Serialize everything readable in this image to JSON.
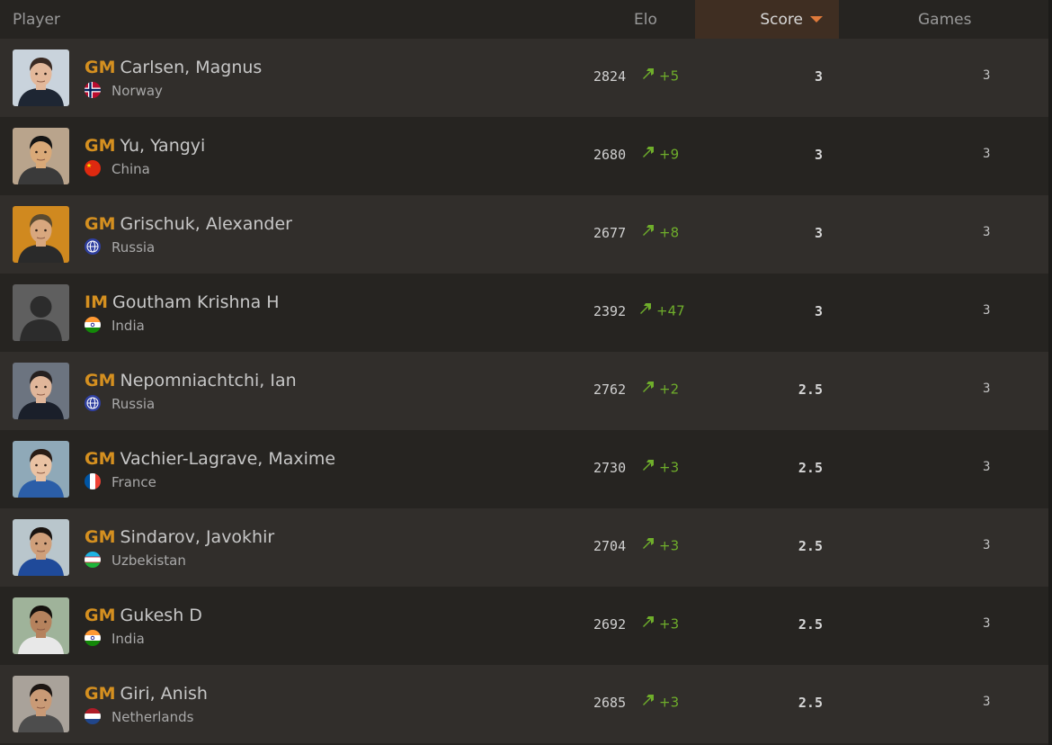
{
  "header": {
    "player": "Player",
    "elo": "Elo",
    "score": "Score",
    "games": "Games"
  },
  "colors": {
    "background": "#262421",
    "row_alt": "#312e2b",
    "title_gold": "#d59020",
    "delta_green": "#6fae2b",
    "sort_accent": "#e07a3b"
  },
  "players": [
    {
      "title": "GM",
      "name": "Carlsen, Magnus",
      "country": "Norway",
      "flag_icon": "norway-flag-icon",
      "elo": "2824",
      "delta": "+5",
      "score": "3",
      "games": "3"
    },
    {
      "title": "GM",
      "name": "Yu, Yangyi",
      "country": "China",
      "flag_icon": "china-flag-icon",
      "elo": "2680",
      "delta": "+9",
      "score": "3",
      "games": "3"
    },
    {
      "title": "GM",
      "name": "Grischuk, Alexander",
      "country": "Russia",
      "flag_icon": "globe-flag-icon",
      "elo": "2677",
      "delta": "+8",
      "score": "3",
      "games": "3"
    },
    {
      "title": "IM",
      "name": "Goutham Krishna H",
      "country": "India",
      "flag_icon": "india-flag-icon",
      "elo": "2392",
      "delta": "+47",
      "score": "3",
      "games": "3"
    },
    {
      "title": "GM",
      "name": "Nepomniachtchi, Ian",
      "country": "Russia",
      "flag_icon": "globe-flag-icon",
      "elo": "2762",
      "delta": "+2",
      "score": "2.5",
      "games": "3"
    },
    {
      "title": "GM",
      "name": "Vachier-Lagrave, Maxime",
      "country": "France",
      "flag_icon": "france-flag-icon",
      "elo": "2730",
      "delta": "+3",
      "score": "2.5",
      "games": "3"
    },
    {
      "title": "GM",
      "name": "Sindarov, Javokhir",
      "country": "Uzbekistan",
      "flag_icon": "uzbekistan-flag-icon",
      "elo": "2704",
      "delta": "+3",
      "score": "2.5",
      "games": "3"
    },
    {
      "title": "GM",
      "name": "Gukesh D",
      "country": "India",
      "flag_icon": "india-flag-icon",
      "elo": "2692",
      "delta": "+3",
      "score": "2.5",
      "games": "3"
    },
    {
      "title": "GM",
      "name": "Giri, Anish",
      "country": "Netherlands",
      "flag_icon": "netherlands-flag-icon",
      "elo": "2685",
      "delta": "+3",
      "score": "2.5",
      "games": "3"
    }
  ]
}
